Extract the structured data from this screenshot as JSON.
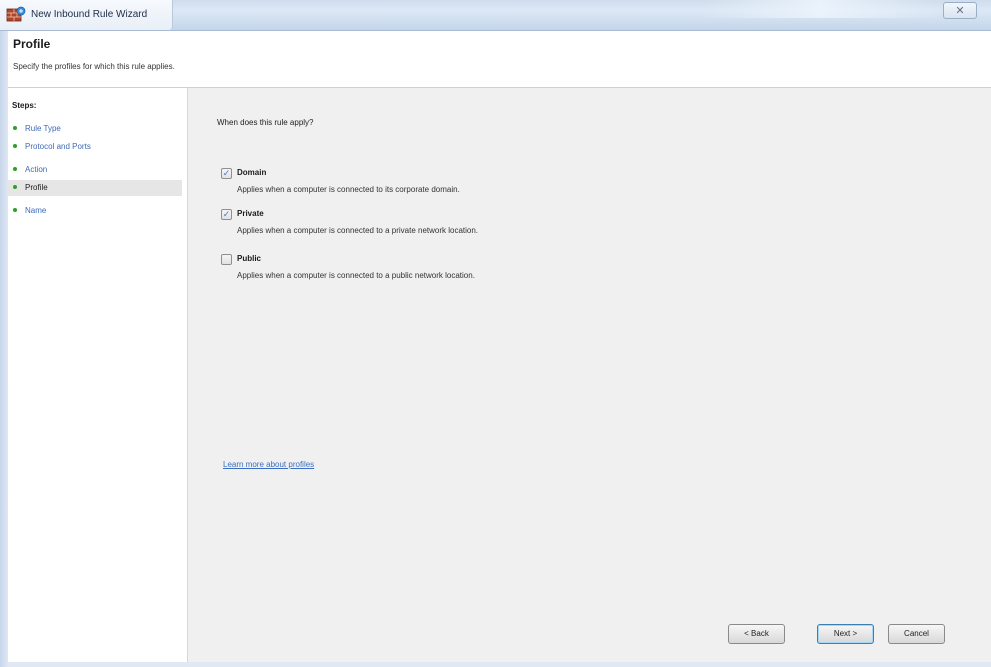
{
  "window": {
    "title": "New Inbound Rule Wizard",
    "close_glyph": "✕"
  },
  "header": {
    "title": "Profile",
    "subtitle": "Specify the profiles for which this rule applies."
  },
  "steps": {
    "title": "Steps:",
    "items": [
      {
        "label": "Rule Type",
        "current": false
      },
      {
        "label": "Protocol and Ports",
        "current": false
      },
      {
        "label": "Action",
        "current": false
      },
      {
        "label": "Profile",
        "current": true
      },
      {
        "label": "Name",
        "current": false
      }
    ]
  },
  "content": {
    "question": "When does this rule apply?",
    "options": [
      {
        "label": "Domain",
        "description": "Applies when a computer is connected to its corporate domain.",
        "checked": true
      },
      {
        "label": "Private",
        "description": "Applies when a computer is connected to a private network location.",
        "checked": true
      },
      {
        "label": "Public",
        "description": "Applies when a computer is connected to a public network location.",
        "checked": false
      }
    ],
    "learn_more": "Learn more about profiles"
  },
  "buttons": {
    "back": "< Back",
    "next": "Next >",
    "cancel": "Cancel"
  },
  "colors": {
    "link": "#3a6fc4",
    "step_bullet": "#2aa02a",
    "content_bg": "#f0f0f0"
  }
}
